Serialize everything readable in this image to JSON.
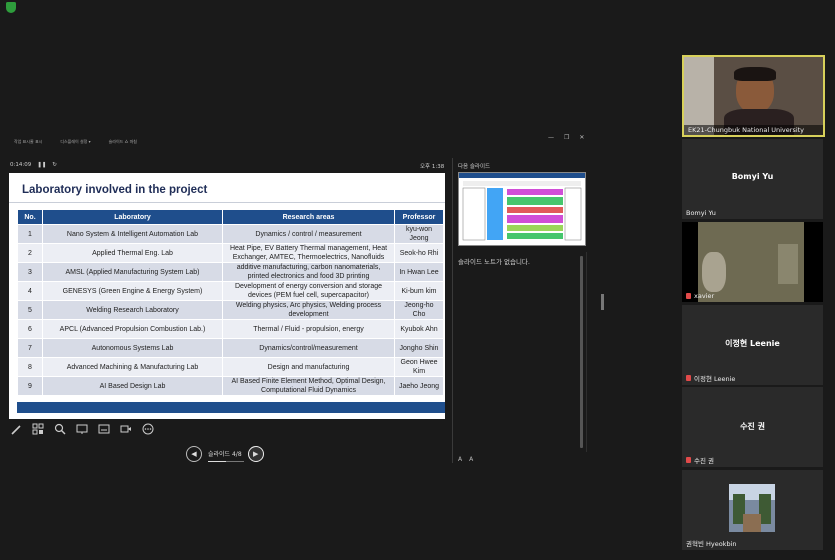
{
  "toolbar": {
    "items": [
      "작업 표시줄 표시",
      "디스플레이 설정 ▾",
      "슬라이드 쇼 마침"
    ]
  },
  "window": {
    "min": "—",
    "restore": "❐",
    "close": "✕"
  },
  "presenter": {
    "timer": "0:14:09",
    "pause": "❚❚",
    "reset": "↻",
    "clock": "오후 1:38",
    "next_slide_label": "다음 슬라이드",
    "notes": "슬라이드 노트가 없습니다.",
    "font_up": "A",
    "font_down": "A",
    "slide_counter": "슬라이드 4/8",
    "prev": "◀",
    "next": "▶"
  },
  "slide": {
    "title": "Laboratory involved in the project",
    "headers": [
      "No.",
      "Laboratory",
      "Research areas",
      "Professor"
    ],
    "rows": [
      [
        "1",
        "Nano System & Intelligent Automation Lab",
        "Dynamics / control / measurement",
        "kyu-won Jeong"
      ],
      [
        "2",
        "Applied Thermal Eng. Lab",
        "Heat Pipe, EV Battery Thermal management, Heat Exchanger, AMTEC, Thermoelectrics, Nanofluids",
        "Seok-ho Rhi"
      ],
      [
        "3",
        "AMSL (Applied Manufacturing System Lab)",
        "additive manufacturing, carbon nanomaterials, printed electronics and food 3D printing",
        "In Hwan Lee"
      ],
      [
        "4",
        "GENESYS (Green Engine & Energy System)",
        "Development of energy conversion and storage devices (PEM fuel cell, supercapacitor)",
        "Ki-bum kim"
      ],
      [
        "5",
        "Welding Research Laboratory",
        "Welding physics, Arc physics, Welding process development",
        "Jeong-ho Cho"
      ],
      [
        "6",
        "APCL (Advanced Propulsion Combustion Lab.)",
        "Thermal / Fluid - propulsion, energy",
        "Kyubok Ahn"
      ],
      [
        "7",
        "Autonomous Systems Lab",
        "Dynamics/control/measurement",
        "Jongho Shin"
      ],
      [
        "8",
        "Advanced Machining & Manufacturing Lab",
        "Design and manufacturing",
        "Geon Hwee Kim"
      ],
      [
        "9",
        "AI Based Design Lab",
        "AI Based Finite Element Method, Optimal Design, Computational Fluid Dynamics",
        "Jaeho Jeong"
      ]
    ]
  },
  "participants": [
    {
      "center": "",
      "name": "EK21-Chungbuk National University",
      "mic": false
    },
    {
      "center": "Bomyi Yu",
      "name": "Bomyi Yu",
      "mic": false
    },
    {
      "center": "",
      "name": "xavier",
      "mic": true
    },
    {
      "center": "이정현 Leenie",
      "name": "이정현 Leenie",
      "mic": true
    },
    {
      "center": "수진 권",
      "name": "수진 권",
      "mic": true
    },
    {
      "center": "",
      "name": "권혁빈 Hyeokbin",
      "mic": false
    }
  ]
}
